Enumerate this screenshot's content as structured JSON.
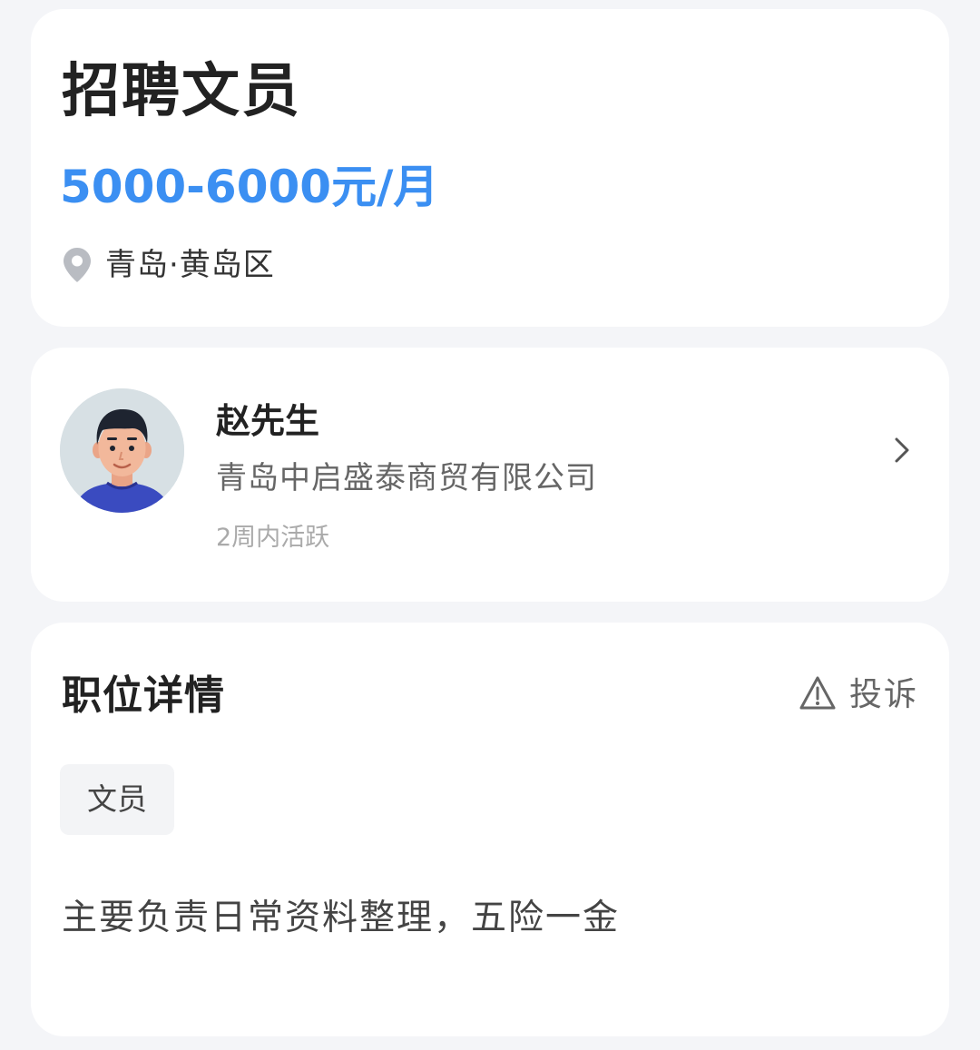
{
  "job": {
    "title": "招聘文员",
    "salary": "5000-6000元/月",
    "location": "青岛·黄岛区",
    "location_icon": "location-pin-icon"
  },
  "recruiter": {
    "name": "赵先生",
    "company": "青岛中启盛泰商贸有限公司",
    "active_status": "2周内活跃",
    "avatar_icon": "avatar",
    "chevron_icon": "chevron-right-icon"
  },
  "details": {
    "section_title": "职位详情",
    "report_label": "投诉",
    "report_icon": "warning-icon",
    "tag": "文员",
    "description": "主要负责日常资料整理，五险一金"
  },
  "colors": {
    "accent": "#3b8ff2",
    "background": "#f4f5f8",
    "card": "#ffffff"
  }
}
